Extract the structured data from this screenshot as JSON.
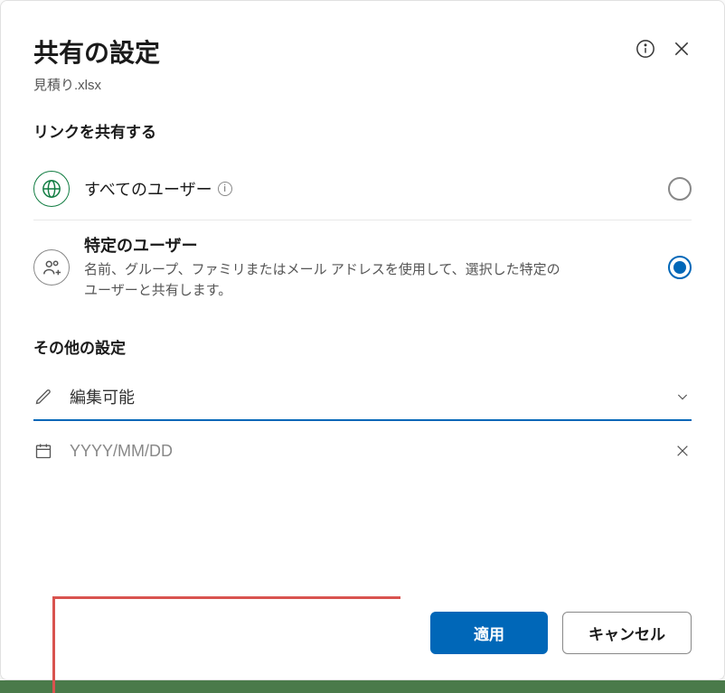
{
  "header": {
    "title": "共有の設定",
    "subtitle": "見積り.xlsx"
  },
  "link_section": {
    "title": "リンクを共有する",
    "options": [
      {
        "label": "すべてのユーザー",
        "desc": "",
        "selected": false,
        "icon": "globe"
      },
      {
        "label": "特定のユーザー",
        "desc": "名前、グループ、ファミリまたはメール アドレスを使用して、選択した特定のユーザーと共有します。",
        "selected": true,
        "icon": "people"
      }
    ]
  },
  "more_section": {
    "title": "その他の設定",
    "permission": {
      "value": "編集可能"
    },
    "expiry": {
      "placeholder": "YYYY/MM/DD"
    }
  },
  "footer": {
    "apply": "適用",
    "cancel": "キャンセル"
  }
}
